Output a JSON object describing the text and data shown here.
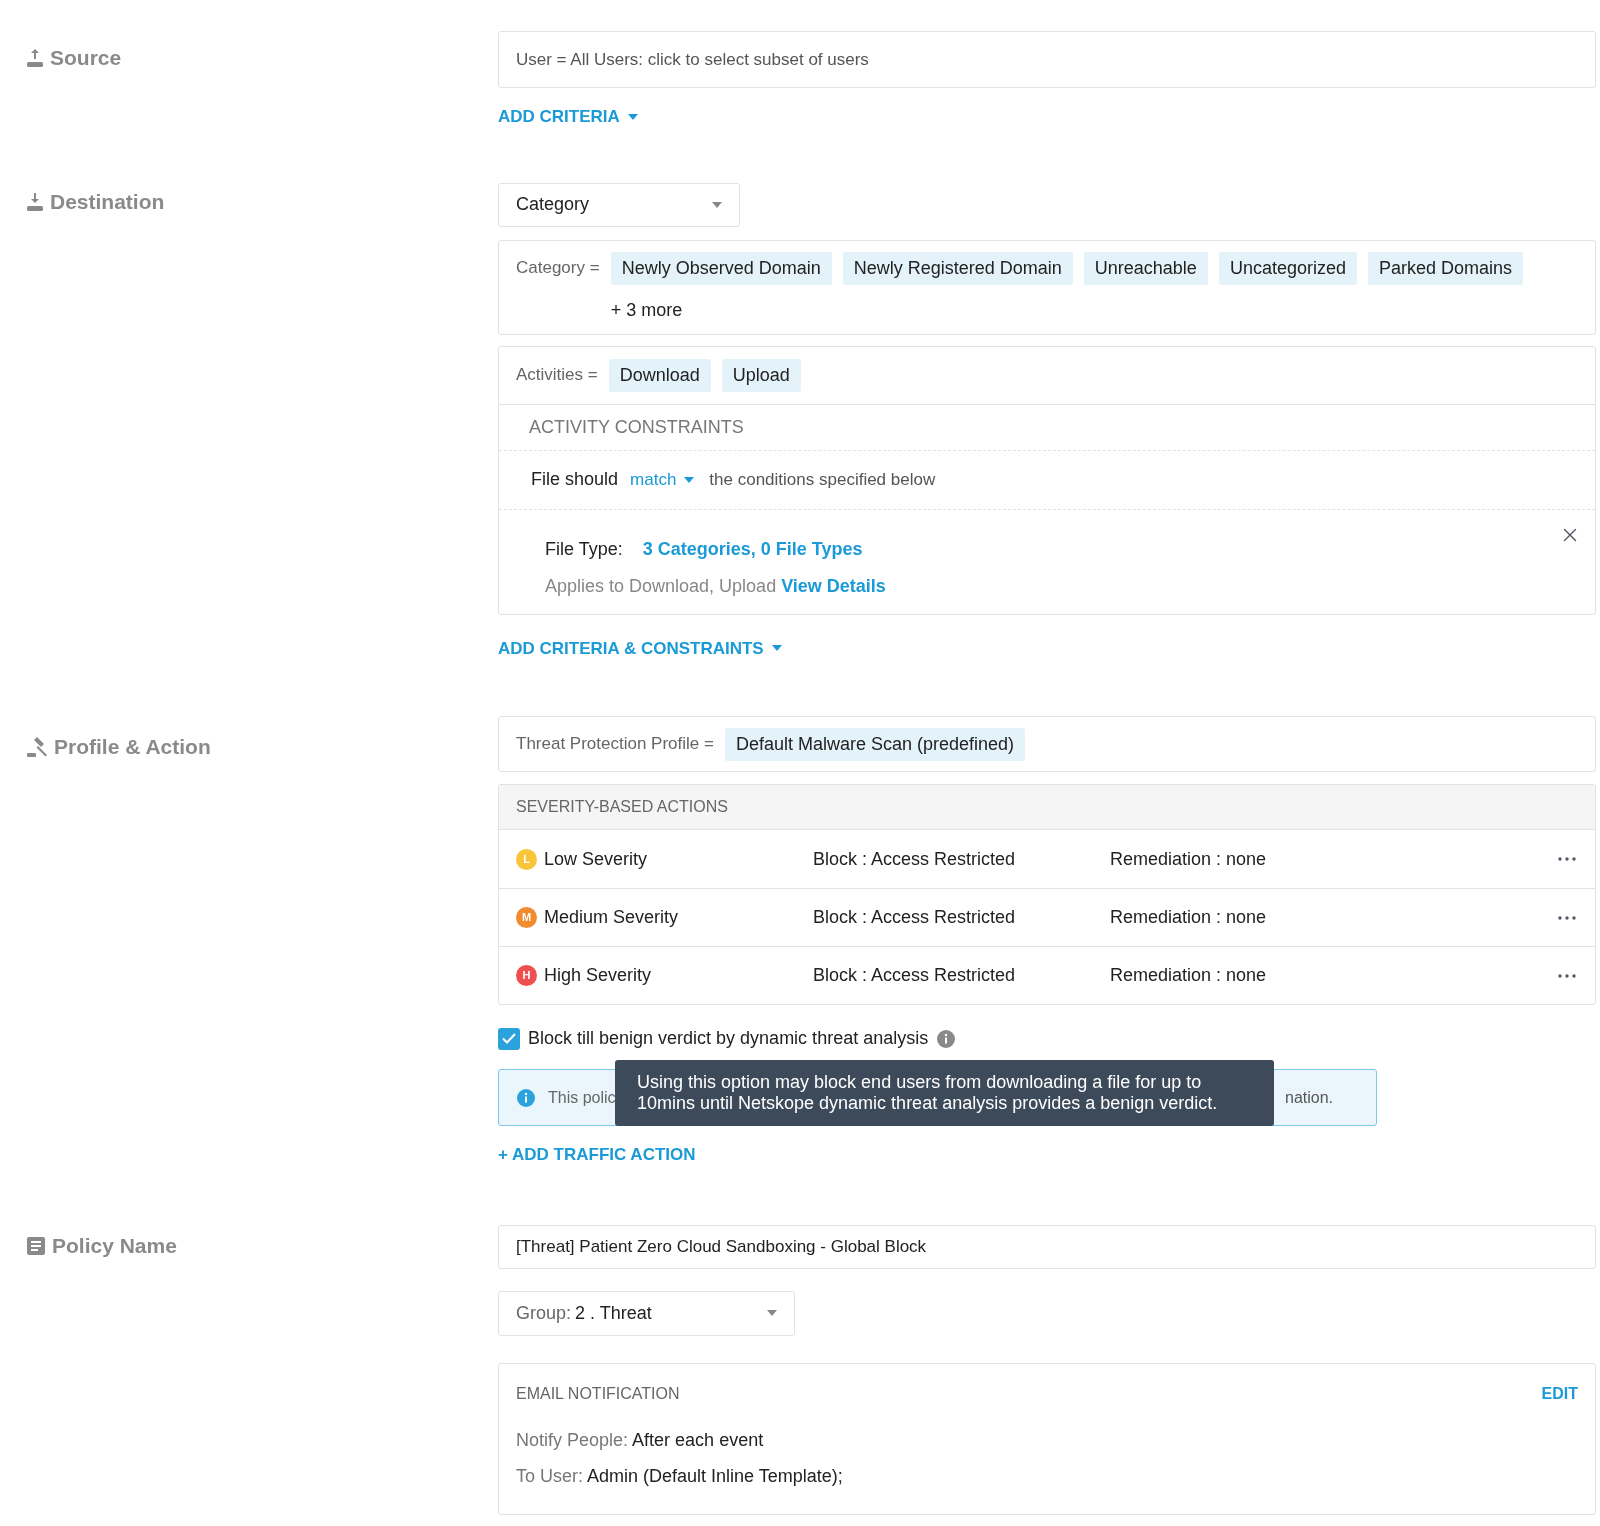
{
  "source": {
    "label": "Source",
    "field_value": "User = All Users: click to select subset of users",
    "add_button": "ADD CRITERIA"
  },
  "destination": {
    "label": "Destination",
    "dropdown": "Category",
    "category": {
      "label": "Category =",
      "chips": [
        "Newly Observed Domain",
        "Newly Registered Domain",
        "Unreachable",
        "Uncategorized",
        "Parked Domains"
      ],
      "more": "+ 3 more"
    },
    "activities": {
      "label": "Activities =",
      "chips": [
        "Download",
        "Upload"
      ]
    },
    "constraints": {
      "title": "ACTIVITY CONSTRAINTS",
      "prefix": "File should",
      "match": "match",
      "suffix": "the conditions specified below",
      "file_type": {
        "label": "File Type:",
        "value": "3 Categories, 0 File Types",
        "applies": "Applies to Download, Upload",
        "link": "View Details"
      }
    },
    "add_button": "ADD CRITERIA & CONSTRAINTS"
  },
  "profile": {
    "label": "Profile & Action",
    "profile_label": "Threat Protection Profile =",
    "profile_chip": "Default Malware Scan (predefined)",
    "severity_title": "SEVERITY-BASED ACTIONS",
    "severities": [
      {
        "badge": "L",
        "name": "Low Severity",
        "action": "Block : Access Restricted",
        "remediation": "Remediation : none",
        "color": "#f8c53a"
      },
      {
        "badge": "M",
        "name": "Medium Severity",
        "action": "Block : Access Restricted",
        "remediation": "Remediation : none",
        "color": "#f28a2e"
      },
      {
        "badge": "H",
        "name": "High Severity",
        "action": "Block : Access Restricted",
        "remediation": "Remediation : none",
        "color": "#ee5050"
      }
    ],
    "checkbox": {
      "label": "Block till benign verdict by dynamic threat analysis",
      "checked": true
    },
    "banner": {
      "start": "This polic",
      "end": "nation."
    },
    "tooltip": "Using this option may block end users from downloading a file for up to 10mins until Netskope dynamic threat analysis provides a benign verdict.",
    "add_button": "+ ADD TRAFFIC ACTION"
  },
  "policy": {
    "label": "Policy Name",
    "name_value": "[Threat] Patient Zero Cloud Sandboxing - Global Block",
    "group": {
      "label": "Group:",
      "value": "2 . Threat"
    },
    "email": {
      "title": "EMAIL NOTIFICATION",
      "edit": "EDIT",
      "lines": [
        {
          "label": "Notify People:",
          "value": "After each event"
        },
        {
          "label": "To User:",
          "value": "Admin (Default Inline Template);"
        }
      ]
    }
  }
}
